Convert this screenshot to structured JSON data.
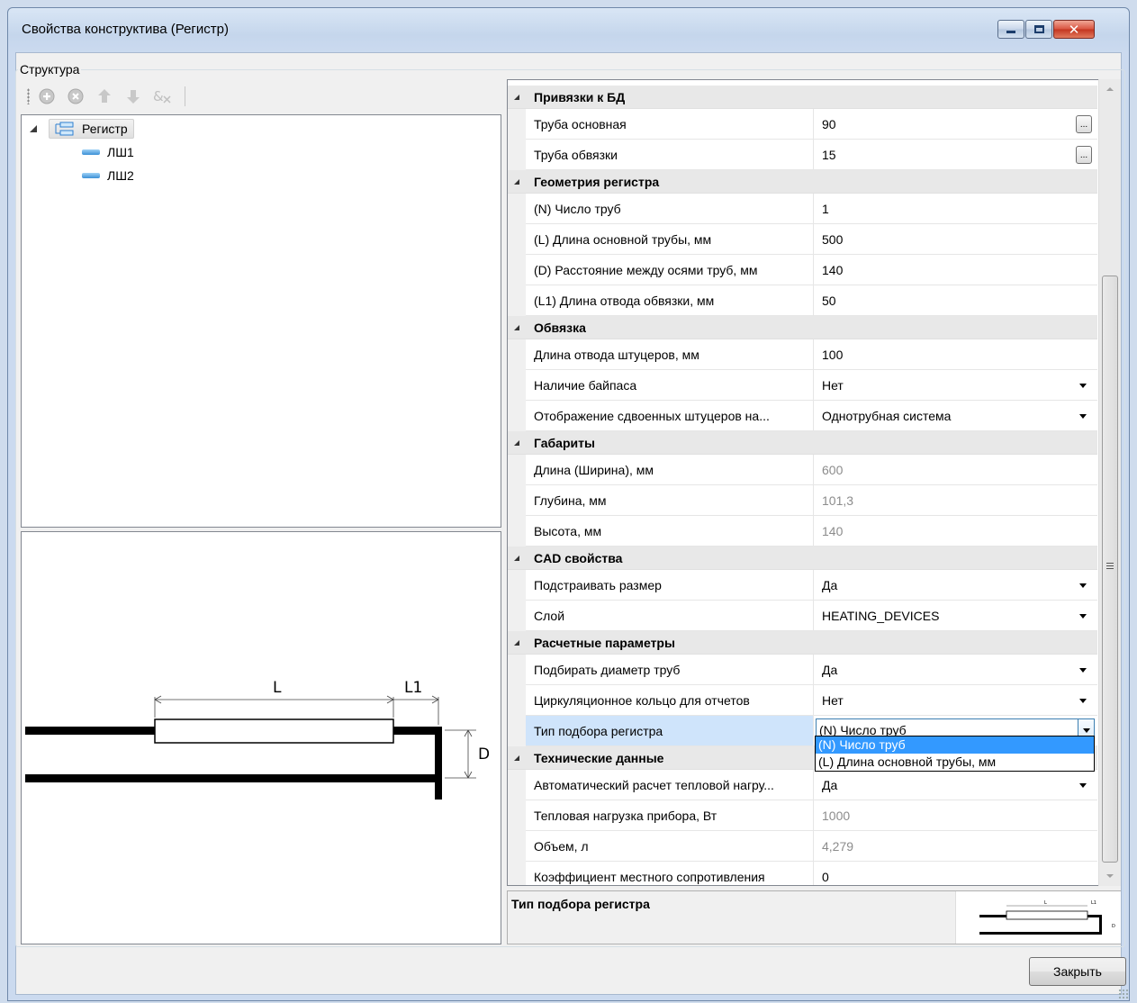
{
  "window": {
    "title": "Свойства конструктива (Регистр)"
  },
  "structure": {
    "group_label": "Структура",
    "tree": {
      "root": "Регистр",
      "children": [
        "ЛШ1",
        "ЛШ2"
      ]
    }
  },
  "toolbar": {
    "icons": [
      "add-icon",
      "remove-icon",
      "move-up-icon",
      "move-down-icon",
      "rename-icon"
    ]
  },
  "preview": {
    "label_l": "L",
    "label_l1": "L1",
    "label_d": "D"
  },
  "properties": {
    "categories": [
      {
        "name": "Привязки к БД",
        "rows": [
          {
            "name": "Труба основная",
            "value": "90",
            "editor": "dots"
          },
          {
            "name": "Труба обвязки",
            "value": "15",
            "editor": "dots"
          }
        ]
      },
      {
        "name": "Геометрия регистра",
        "rows": [
          {
            "name": "(N) Число труб",
            "value": "1"
          },
          {
            "name": "(L) Длина основной трубы, мм",
            "value": "500"
          },
          {
            "name": "(D) Расстояние между осями труб, мм",
            "value": "140"
          },
          {
            "name": "(L1) Длина отвода обвязки, мм",
            "value": "50"
          }
        ]
      },
      {
        "name": "Обвязка",
        "rows": [
          {
            "name": "Длина отвода штуцеров, мм",
            "value": "100"
          },
          {
            "name": "Наличие байпаса",
            "value": "Нет",
            "editor": "dropdown"
          },
          {
            "name": "Отображение сдвоенных штуцеров на...",
            "value": "Однотрубная система",
            "editor": "dropdown"
          }
        ]
      },
      {
        "name": "Габариты",
        "rows": [
          {
            "name": "Длина (Ширина), мм",
            "value": "600",
            "readonly": true
          },
          {
            "name": "Глубина, мм",
            "value": "101,3",
            "readonly": true
          },
          {
            "name": "Высота, мм",
            "value": "140",
            "readonly": true
          }
        ]
      },
      {
        "name": "CAD свойства",
        "rows": [
          {
            "name": "Подстраивать размер",
            "value": "Да",
            "editor": "dropdown"
          },
          {
            "name": "Слой",
            "value": "HEATING_DEVICES",
            "editor": "dropdown"
          }
        ]
      },
      {
        "name": "Расчетные параметры",
        "rows": [
          {
            "name": "Подбирать диаметр труб",
            "value": "Да",
            "editor": "dropdown"
          },
          {
            "name": "Циркуляционное кольцо для отчетов",
            "value": "Нет",
            "editor": "dropdown"
          },
          {
            "name": "Тип подбора регистра",
            "value": "(N) Число труб",
            "editor": "combo-open",
            "selected": true
          }
        ]
      },
      {
        "name": "Технические данные",
        "rows": [
          {
            "name": "Автоматический расчет тепловой нагру...",
            "value": "Да",
            "editor": "dropdown"
          },
          {
            "name": "Тепловая нагрузка прибора, Вт",
            "value": "1000",
            "readonly": true
          },
          {
            "name": "Объем, л",
            "value": "4,279",
            "readonly": true
          },
          {
            "name": "Коэффициент местного сопротивления",
            "value": "0"
          }
        ]
      }
    ],
    "dropdown_options": [
      "(N) Число труб",
      "(L) Длина основной трубы, мм"
    ],
    "dropdown_highlighted": "(N) Число труб"
  },
  "description": {
    "title": "Тип подбора регистра"
  },
  "buttons": {
    "close": "Закрыть"
  },
  "colors": {
    "selection": "#3399ff",
    "selected_row": "#cfe4fb",
    "category_bg": "#e8e8e8"
  }
}
